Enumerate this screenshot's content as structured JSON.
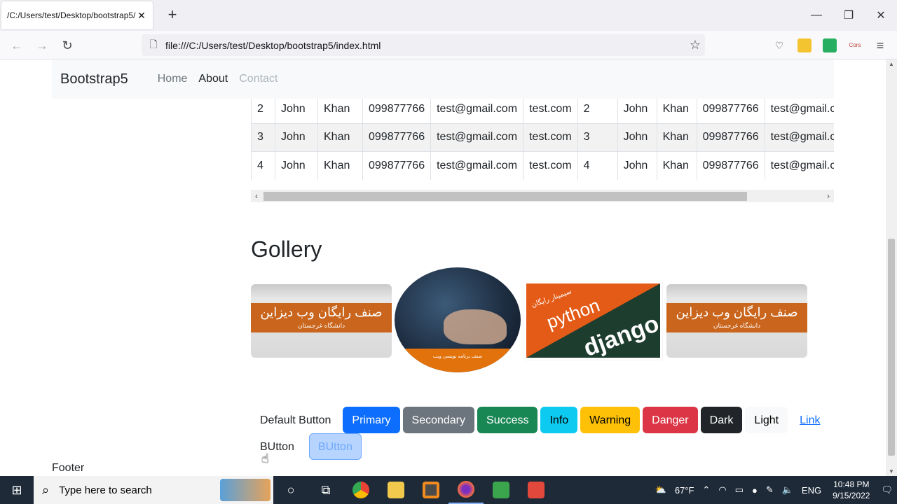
{
  "browser": {
    "tab_title": "/C:/Users/test/Desktop/bootstrap5/",
    "tab_close": "✕",
    "new_tab": "+",
    "url": "file:///C:/Users/test/Desktop/bootstrap5/index.html",
    "back": "←",
    "forward": "→",
    "reload": "↻",
    "bookmark": "☆",
    "minimize": "—",
    "restore": "❐",
    "close": "✕",
    "menu": "≡",
    "ext_cors_label": "Cors"
  },
  "navbar": {
    "brand": "Bootstrap5",
    "links": [
      "Home",
      "About",
      "Contact"
    ]
  },
  "table": {
    "rows": [
      [
        "2",
        "John",
        "Khan",
        "099877766",
        "test@gmail.com",
        "test.com",
        "2",
        "John",
        "Khan",
        "099877766",
        "test@gmail.com"
      ],
      [
        "3",
        "John",
        "Khan",
        "099877766",
        "test@gmail.com",
        "test.com",
        "3",
        "John",
        "Khan",
        "099877766",
        "test@gmail.com"
      ],
      [
        "4",
        "John",
        "Khan",
        "099877766",
        "test@gmail.com",
        "test.com",
        "4",
        "John",
        "Khan",
        "099877766",
        "test@gmail.com"
      ]
    ]
  },
  "gallery": {
    "heading": "Gollery",
    "img1_title": "صنف رایگان وب دیزاین",
    "img1_sub": "دانشگاه غرجستان",
    "img2_caption": "صنف برنامه نویسی ویب",
    "img3_python": "python",
    "img3_django": "django",
    "img3_fa": "سیمینار رایگان",
    "img4_title": "صنف رایگان وب دیزاین",
    "img4_sub": "دانشگاه غرجستان"
  },
  "buttons": {
    "default": "Default Button",
    "primary": "Primary",
    "secondary": "Secondary",
    "success": "Success",
    "info": "Info",
    "warning": "Warning",
    "danger": "Danger",
    "dark": "Dark",
    "light": "Light",
    "link": "Link",
    "plain": "BUtton",
    "outline": "BUtton"
  },
  "footer": "Footer",
  "taskbar": {
    "search_placeholder": "Type here to search",
    "temperature": "67°F",
    "language": "ENG",
    "time": "10:48 PM",
    "date": "9/15/2022"
  }
}
